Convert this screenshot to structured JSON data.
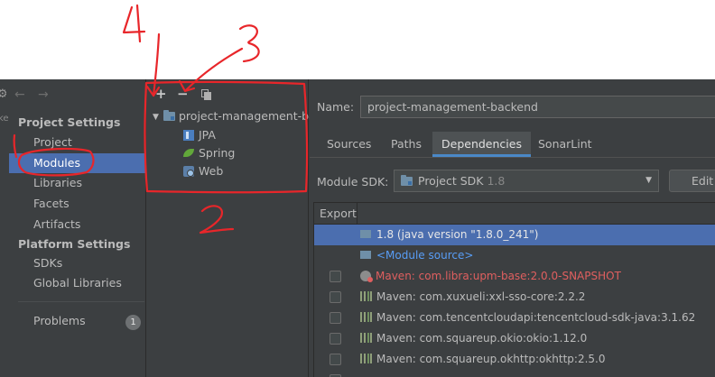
{
  "annotations": {
    "label_4": "4",
    "label_3": "3",
    "label_2": "2",
    "label_1": "1"
  },
  "sidebar": {
    "sections": [
      {
        "title": "Project Settings",
        "items": [
          "Project",
          "Modules",
          "Libraries",
          "Facets",
          "Artifacts"
        ]
      },
      {
        "title": "Platform Settings",
        "items": [
          "SDKs",
          "Global Libraries"
        ]
      }
    ],
    "problems_label": "Problems",
    "problems_count": "1",
    "selected": "Modules",
    "partial_text": "ke"
  },
  "tree": {
    "add_glyph": "+",
    "remove_glyph": "−",
    "root": "project-management-backend",
    "children": [
      "JPA",
      "Spring",
      "Web"
    ]
  },
  "details": {
    "name_label": "Name:",
    "name_value": "project-management-backend",
    "tabs": [
      "Sources",
      "Paths",
      "Dependencies",
      "SonarLint"
    ],
    "active_tab": "Dependencies",
    "sdk_label": "Module SDK:",
    "sdk_value": "Project SDK",
    "sdk_version": "1.8",
    "edit_label": "Edit",
    "export_header": "Export",
    "dependencies": [
      {
        "text": "1.8 (java version \"1.8.0_241\")",
        "kind": "sdk"
      },
      {
        "text": "<Module source>",
        "kind": "source"
      },
      {
        "text": "Maven: com.libra:upm-base:2.0.0-SNAPSHOT",
        "kind": "error"
      },
      {
        "text": "Maven: com.xuxueli:xxl-sso-core:2.2.2",
        "kind": "lib"
      },
      {
        "text": "Maven: com.tencentcloudapi:tencentcloud-sdk-java:3.1.62",
        "kind": "lib"
      },
      {
        "text": "Maven: com.squareup.okio:okio:1.12.0",
        "kind": "lib"
      },
      {
        "text": "Maven: com.squareup.okhttp:okhttp:2.5.0",
        "kind": "lib"
      }
    ]
  },
  "colors": {
    "annotation_red": "#e8262a",
    "selection_blue": "#4b6eaf",
    "error_red": "#e05f5f",
    "link_blue": "#589df6"
  }
}
